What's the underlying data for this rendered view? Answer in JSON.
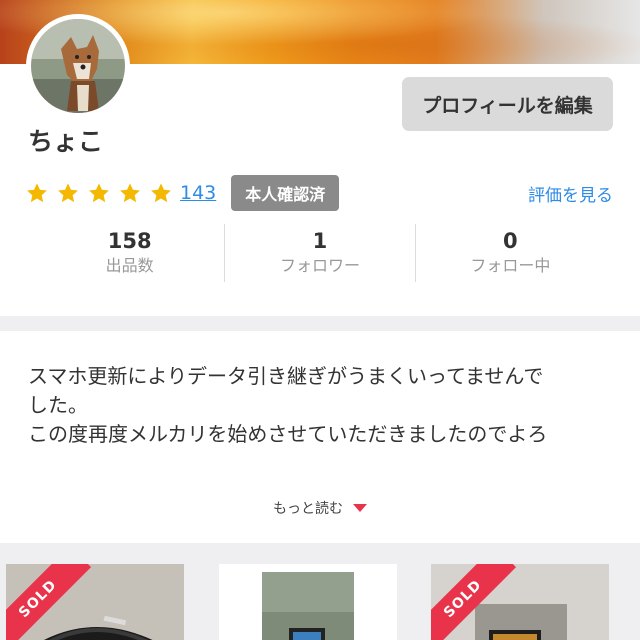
{
  "profile": {
    "username": "ちょこ",
    "edit_button": "プロフィールを編集",
    "rating_stars": 5,
    "review_count": "143",
    "verified_badge": "本人確認済",
    "see_reviews_link": "評価を見る"
  },
  "stats": [
    {
      "value": "158",
      "label": "出品数"
    },
    {
      "value": "1",
      "label": "フォロワー"
    },
    {
      "value": "0",
      "label": "フォロー中"
    }
  ],
  "bio": {
    "lines": [
      "スマホ更新によりデータ引き継ぎがうまくいってませんで",
      "した。",
      "この度再度メルカリを始めさせていただきましたのでよろ"
    ],
    "read_more": "もっと読む"
  },
  "items": [
    {
      "sold_label": "SOLD",
      "sold": true
    },
    {
      "sold_label": "",
      "sold": false
    },
    {
      "sold_label": "SOLD",
      "sold": true
    }
  ],
  "colors": {
    "accent_red": "#e8334a",
    "link_blue": "#2e8be6",
    "star_yellow": "#f5b800"
  }
}
